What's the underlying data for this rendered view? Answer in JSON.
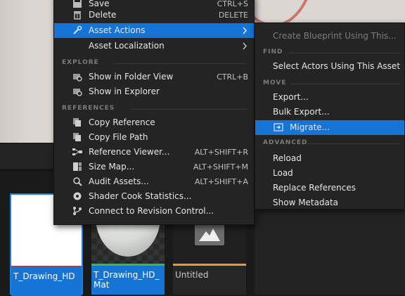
{
  "menu": {
    "items": [
      {
        "label": "Save",
        "shortcut": "CTRL+S",
        "icon": "save-icon"
      },
      {
        "label": "Delete",
        "shortcut": "DELETE",
        "icon": "trash-icon"
      },
      {
        "label": "Asset Actions",
        "shortcut": "",
        "icon": "wrench-icon",
        "has_submenu": true,
        "highlighted": true
      },
      {
        "label": "Asset Localization",
        "shortcut": "",
        "icon": "globe-icon",
        "has_submenu": true
      }
    ],
    "explore_header": "EXPLORE",
    "explore": [
      {
        "label": "Show in Folder View",
        "shortcut": "CTRL+B",
        "icon": "folder-search-icon"
      },
      {
        "label": "Show in Explorer",
        "shortcut": "",
        "icon": "folder-search-icon"
      }
    ],
    "references_header": "REFERENCES",
    "references": [
      {
        "label": "Copy Reference",
        "shortcut": "",
        "icon": "copy-icon"
      },
      {
        "label": "Copy File Path",
        "shortcut": "",
        "icon": "copy-icon"
      },
      {
        "label": "Reference Viewer...",
        "shortcut": "ALT+SHIFT+R",
        "icon": "reference-viewer-icon"
      },
      {
        "label": "Size Map...",
        "shortcut": "ALT+SHIFT+M",
        "icon": "size-map-icon"
      },
      {
        "label": "Audit Assets...",
        "shortcut": "ALT+SHIFT+A",
        "icon": "audit-icon"
      },
      {
        "label": "Shader Cook Statistics...",
        "shortcut": "",
        "icon": "shader-icon"
      },
      {
        "label": "Connect to Revision Control...",
        "shortcut": "",
        "icon": "revision-control-icon"
      }
    ]
  },
  "submenu": {
    "top_item": {
      "label": "Create Blueprint Using This...",
      "disabled": true
    },
    "find_header": "FIND",
    "find": [
      {
        "label": "Select Actors Using This Asset"
      }
    ],
    "move_header": "MOVE",
    "move": [
      {
        "label": "Export..."
      },
      {
        "label": "Bulk Export..."
      },
      {
        "label": "Migrate...",
        "icon": "migrate-icon",
        "highlighted": true
      }
    ],
    "advanced_header": "ADVANCED",
    "advanced": [
      {
        "label": "Reload"
      },
      {
        "label": "Load"
      },
      {
        "label": "Replace References"
      },
      {
        "label": "Show Metadata"
      }
    ]
  },
  "assets": [
    {
      "name": "T_Drawing_HD",
      "selected": true
    },
    {
      "name": "T_Drawing_HD_\nMat",
      "selected": true
    },
    {
      "name": "Untitled",
      "selected": false
    }
  ],
  "colors": {
    "highlight": "#1574d4",
    "menu_bg": "#242424",
    "texture_underline": "#b83c3c",
    "material_underline": "#3bb55a",
    "untitled_underline": "#e79a2a"
  }
}
